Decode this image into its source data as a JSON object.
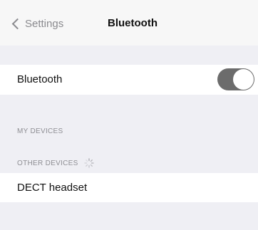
{
  "navbar": {
    "back_label": "Settings",
    "title": "Bluetooth"
  },
  "bluetooth": {
    "label": "Bluetooth",
    "enabled": true,
    "toggle_color": "#6c6c6c"
  },
  "sections": {
    "my_devices": "MY DEVICES",
    "other_devices": "OTHER DEVICES"
  },
  "devices": {
    "other": [
      {
        "name": "DECT headset"
      }
    ]
  },
  "icons": {
    "back": "chevron-left-icon",
    "spinner": "loading-spinner-icon"
  }
}
